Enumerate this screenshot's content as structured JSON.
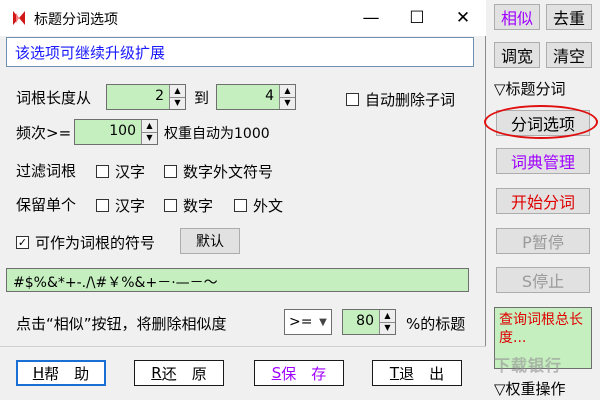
{
  "window": {
    "title": "标题分词选项",
    "minimize_glyph": "—",
    "maximize_glyph": "☐",
    "close_glyph": "✕"
  },
  "banner": "该选项可继续升级扩展",
  "root_length": {
    "label": "词根长度从",
    "from_value": "2",
    "to_label": "到",
    "to_value": "4",
    "auto_delete_label": "自动删除子词",
    "auto_delete_checked": false
  },
  "frequency": {
    "label": "频次>=",
    "value": "100",
    "weight_note": "权重自动为1000"
  },
  "filter": {
    "label": "过滤词根",
    "options": [
      {
        "label": "汉字",
        "checked": false
      },
      {
        "label": "数字外文符号",
        "checked": false
      }
    ]
  },
  "keep_single": {
    "label": "保留单个",
    "options": [
      {
        "label": "汉字",
        "checked": false
      },
      {
        "label": "数字",
        "checked": false
      },
      {
        "label": "外文",
        "checked": false
      }
    ]
  },
  "symbols_root": {
    "label": "可作为词根的符号",
    "checked": true,
    "default_button": "默认",
    "value": "#$%&*+-./\\#￥%&+－·—－～"
  },
  "similarity": {
    "prefix": "点击“相似”按钮，将删除相似度",
    "operator": ">=",
    "value": "80",
    "suffix": "%的标题"
  },
  "buttons": {
    "help_key": "H",
    "help": "帮　助",
    "restore_key": "R",
    "restore": "还　原",
    "save_key": "S",
    "save": "保　存",
    "exit_key": "T",
    "exit": "退　出"
  },
  "side": {
    "similar": "相似",
    "dedupe": "去重",
    "width": "调宽",
    "clear": "清空",
    "section_title": "▽标题分词",
    "seg_options": "分词选项",
    "dict_manage": "词典管理",
    "start_seg": "开始分词",
    "pause": "P暂停",
    "stop": "S停止",
    "lookup_text": "查询词根总长度...",
    "weight_ops": "▽权重操作"
  },
  "watermark": "下载银行",
  "colors": {
    "accent_blue": "#1a1aff",
    "purple": "#a000ff",
    "red": "#e00000",
    "input_green": "#c6efc0"
  }
}
